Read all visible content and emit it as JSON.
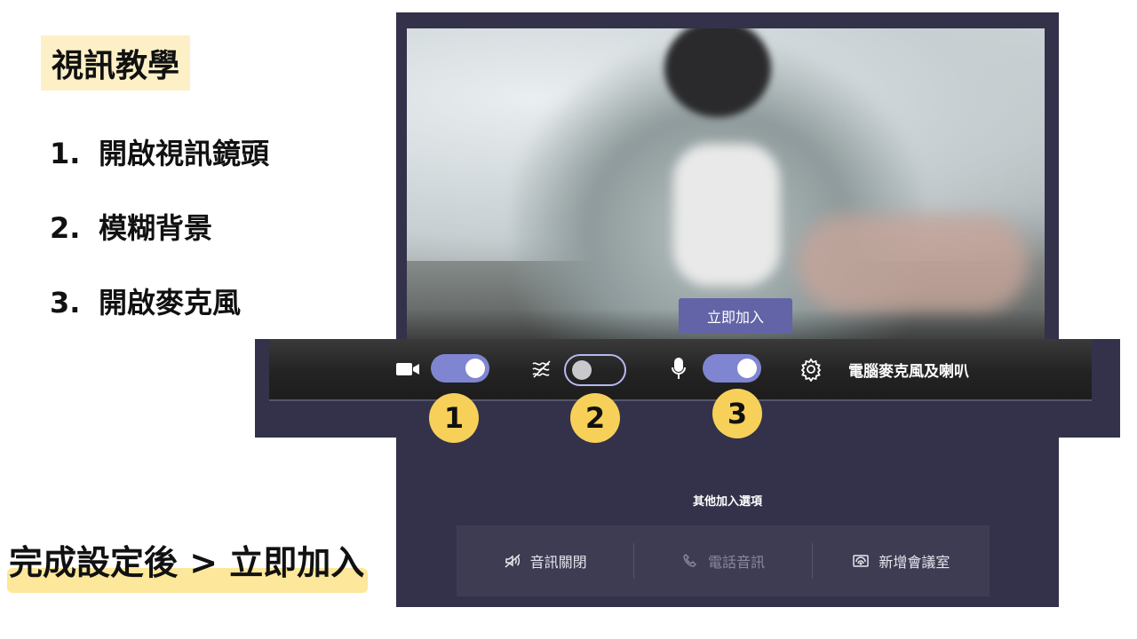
{
  "slide": {
    "title": "視訊教學",
    "steps": [
      {
        "num": "1.",
        "text": "開啟視訊鏡頭"
      },
      {
        "num": "2.",
        "text": "模糊背景"
      },
      {
        "num": "3.",
        "text": "開啟麥克風"
      }
    ],
    "bottom_note": "完成設定後 > 立即加入"
  },
  "prejoin": {
    "join_button": "立即加入",
    "other_options_title": "其他加入選項",
    "options": [
      {
        "label": "音訊關閉",
        "icon": "speaker-off-icon",
        "enabled": true
      },
      {
        "label": "電話音訊",
        "icon": "phone-icon",
        "enabled": false
      },
      {
        "label": "新增會議室",
        "icon": "cast-icon",
        "enabled": true
      }
    ]
  },
  "controls": {
    "camera_toggle_on": true,
    "blur_toggle_on": false,
    "mic_toggle_on": true,
    "device_settings_label": "電腦麥克風及喇叭"
  },
  "badges": [
    "1",
    "2",
    "3"
  ],
  "colors": {
    "accent": "#6264a7",
    "toggle_on": "#7f85d0",
    "badge": "#f7d05a",
    "panel_bg": "#33324a",
    "title_highlight": "#fdf0c6",
    "note_highlight": "#fde79a"
  }
}
